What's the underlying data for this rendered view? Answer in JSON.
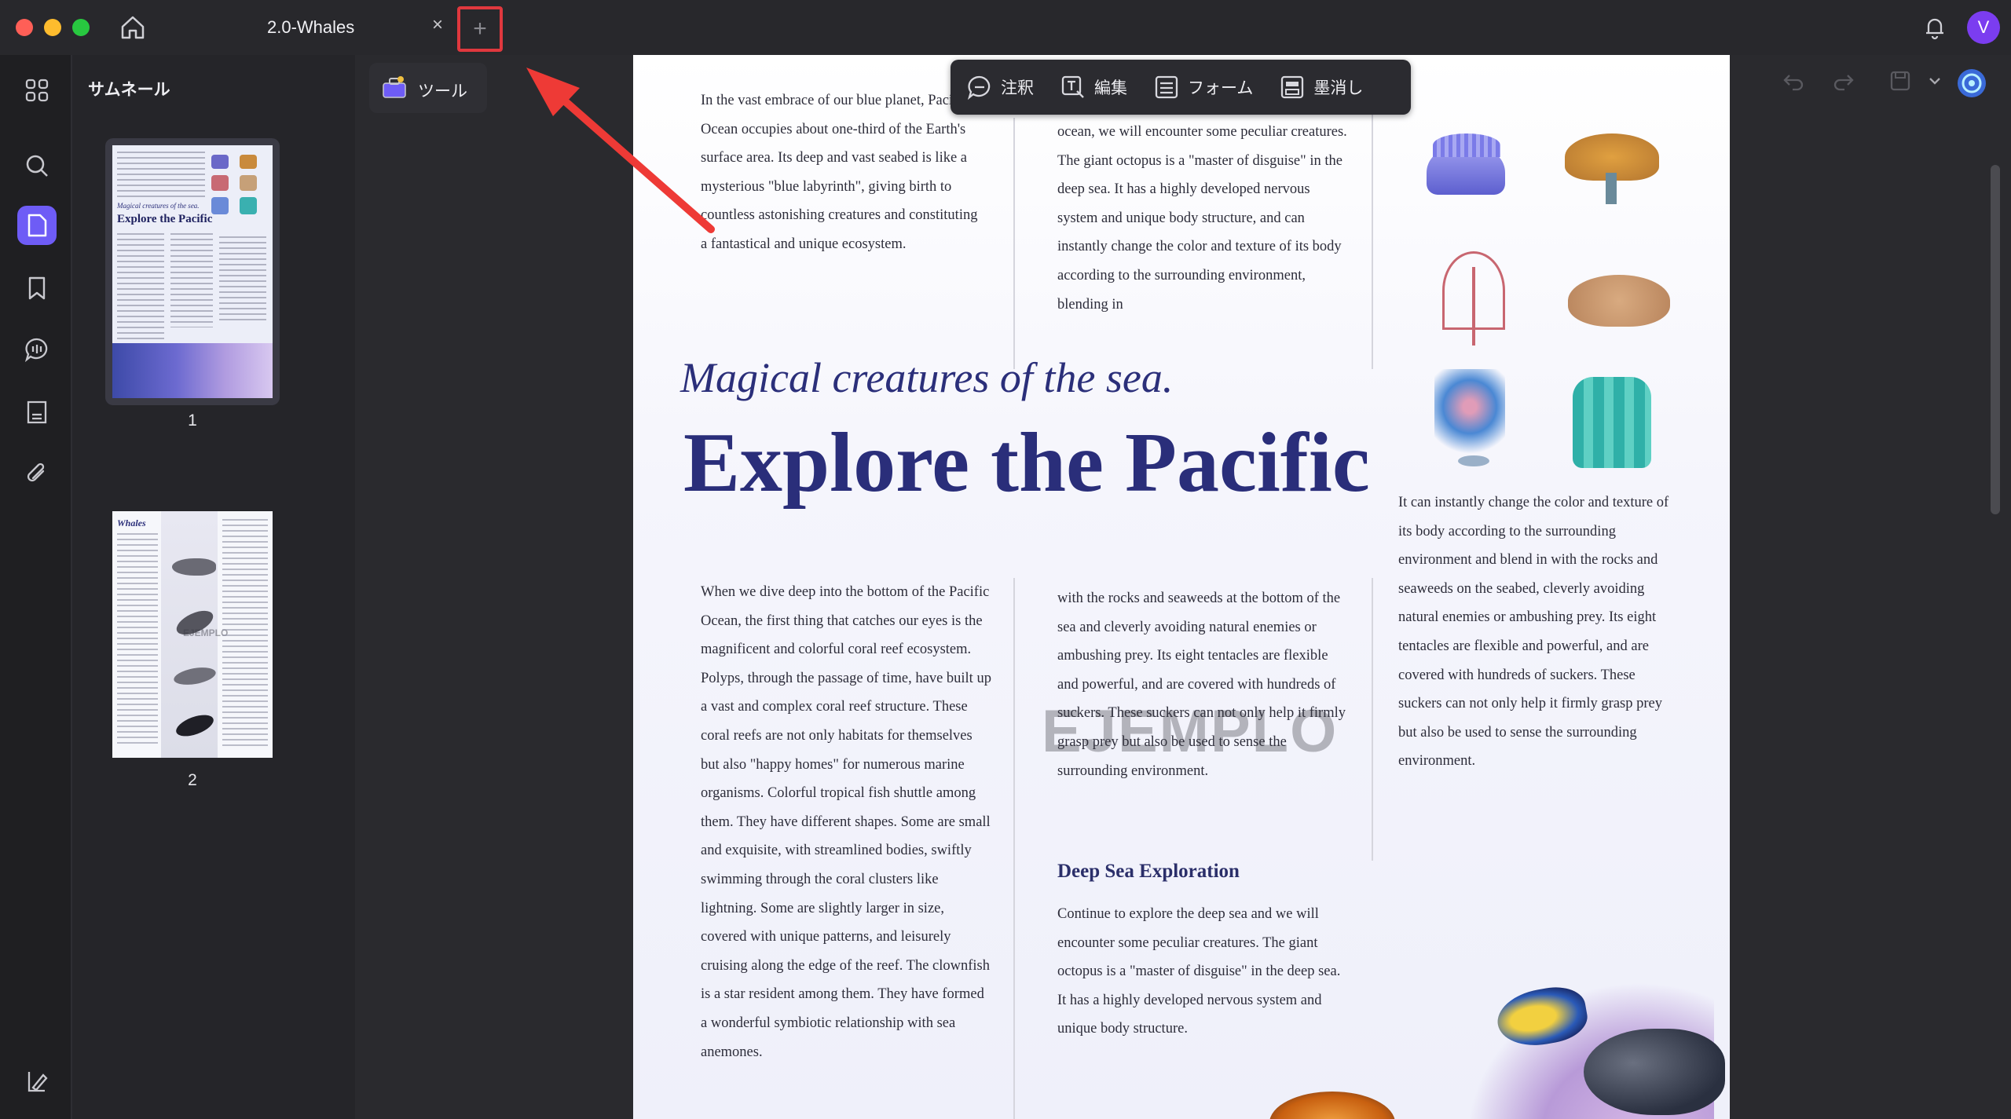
{
  "window": {
    "tab_title": "2.0-Whales",
    "tab_close": "×",
    "new_tab": "+",
    "avatar_letter": "V"
  },
  "sidebar": {
    "title": "サムネール",
    "pages": [
      {
        "number": "1",
        "thumb_italic": "Magical creatures of the sea.",
        "thumb_title": "Explore the Pacific"
      },
      {
        "number": "2",
        "thumb_title": "Whales",
        "thumb_watermark": "EJEMPLO"
      }
    ]
  },
  "tools_button": {
    "label": "ツール"
  },
  "toolbar": {
    "items": [
      "注釈",
      "編集",
      "フォーム",
      "墨消し"
    ]
  },
  "document": {
    "col1_top": "In the vast embrace of our blue planet, Pacific Ocean occupies about one-third of the Earth's surface area. Its deep and vast seabed is like a mysterious \"blue labyrinth\", giving birth to countless astonishing creatures and constituting a fantastical and unique ecosystem.",
    "col2_top": "ocean, we will encounter some peculiar creatures. The giant octopus is a \"master of disguise\" in the deep sea. It has a highly developed nervous system and unique body structure, and can instantly change the color and texture of its body according to the surrounding environment, blending in",
    "italic_title": "Magical creatures of the sea.",
    "main_title": "Explore the Pacific",
    "col1_bottom": "When we dive deep into the bottom of the Pacific Ocean, the first thing that catches our eyes is the magnificent and colorful coral reef ecosystem. Polyps, through the passage of time, have built up a vast and complex coral reef structure. These coral reefs are not only habitats for themselves but also \"happy homes\" for numerous marine organisms. Colorful tropical fish shuttle among them. They have different shapes. Some are small and exquisite, with streamlined bodies, swiftly swimming through the coral clusters like lightning. Some are slightly larger in size, covered with unique patterns, and leisurely cruising along the edge of the reef. The clownfish is a star resident among them. They have formed a wonderful symbiotic relationship with sea anemones.",
    "col2_mid": "with the rocks and seaweeds at the bottom of the sea and cleverly avoiding natural enemies or ambushing prey. Its eight tentacles are flexible and powerful, and are covered with hundreds of suckers. These suckers can not only help it firmly grasp prey but also be used to sense the surrounding environment.",
    "col3_mid": "It can instantly change the color and texture of its body according to the surrounding environment and blend in with the rocks and seaweeds on the seabed, cleverly avoiding natural enemies or ambushing prey. Its eight tentacles are flexible and powerful, and are covered with hundreds of suckers. These suckers can not only help it firmly grasp prey but also be used to sense the surrounding environment.",
    "subheading": "Deep Sea Exploration",
    "col2_bottom": "Continue to explore the deep sea and we will encounter some peculiar creatures. The giant octopus is a \"master of disguise\" in the deep sea. It has a highly developed nervous system and unique body structure.",
    "watermark": "EJEMPLO"
  },
  "colors": {
    "accent": "#6e5cf6",
    "highlight": "#e0383e",
    "title_navy": "#2a2e7a"
  },
  "icons": {
    "sidebar": [
      "grid-icon",
      "search-icon",
      "thumbnails-icon",
      "bookmark-icon",
      "comment-icon",
      "form-icon",
      "attachment-icon",
      "layers-icon"
    ],
    "right": [
      "undo-icon",
      "redo-icon",
      "save-icon",
      "chevron-down-icon",
      "ai-assistant-icon"
    ]
  }
}
